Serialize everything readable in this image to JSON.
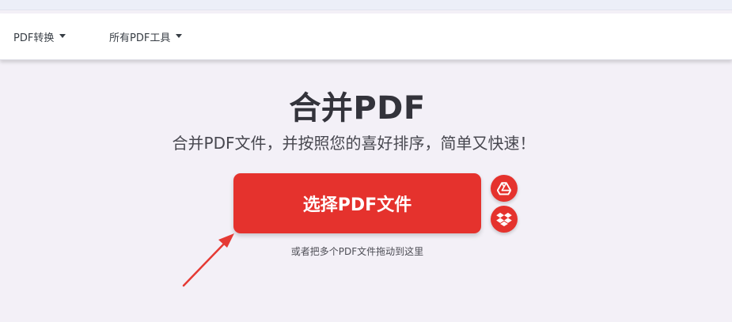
{
  "nav": {
    "items": [
      {
        "label": "PDF转换"
      },
      {
        "label": "所有PDF工具"
      }
    ]
  },
  "main": {
    "title": "合并PDF",
    "subtitle": "合并PDF文件，并按照您的喜好排序，简单又快速！",
    "select_button_label": "选择PDF文件",
    "drop_hint": "或者把多个PDF文件拖动到这里",
    "cloud_buttons": [
      {
        "icon": "google-drive-icon"
      },
      {
        "icon": "dropbox-icon"
      }
    ]
  },
  "colors": {
    "accent": "#e5322d",
    "annotation_arrow": "#e53a34",
    "background": "#f3f0f7"
  }
}
